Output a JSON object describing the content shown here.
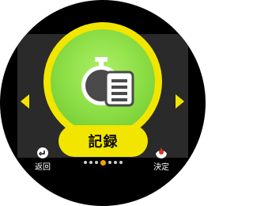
{
  "mode": {
    "label": "記録",
    "icon": "stopwatch-document-icon"
  },
  "navigation": {
    "left_arrow_icon": "chevron-left-icon",
    "right_arrow_icon": "chevron-right-icon",
    "page_count": 7,
    "current_page": 4
  },
  "soft_keys": {
    "back_label": "返回",
    "back_icon": "return-arrow-icon",
    "ok_label": "決定",
    "ok_icon": "confirm-icon"
  },
  "colors": {
    "accent": "#f2e600",
    "disc": "#8fe048",
    "active_dot": "#f2a400",
    "background": "#000000"
  }
}
